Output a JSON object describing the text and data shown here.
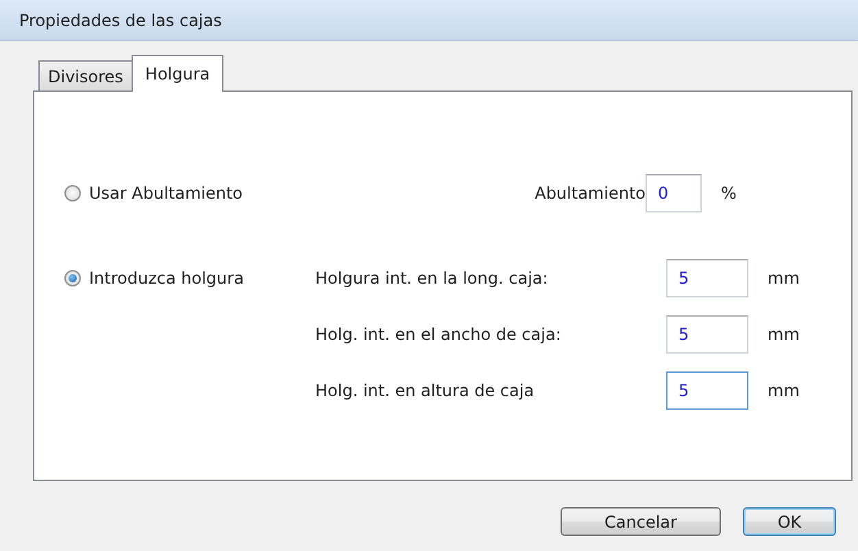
{
  "window": {
    "title": "Propiedades de las cajas"
  },
  "tabs": [
    {
      "label": "Divisores",
      "selected": false
    },
    {
      "label": "Holgura",
      "selected": true
    }
  ],
  "groups": [
    {
      "option": {
        "label": "Usar Abultamiento",
        "selected": false
      },
      "fields": [
        {
          "label": "Abultamiento",
          "value": "0",
          "unit": "%",
          "focused": false
        }
      ]
    },
    {
      "option": {
        "label": "Introduzca holgura",
        "selected": true
      },
      "fields": [
        {
          "label": "Holgura int. en la long. caja:",
          "value": "5",
          "unit": "mm",
          "focused": false
        },
        {
          "label": "Holg. int. en el ancho de caja:",
          "value": "5",
          "unit": "mm",
          "focused": false
        },
        {
          "label": "Holg. int. en altura de caja",
          "value": "5",
          "unit": "mm",
          "focused": true
        }
      ]
    }
  ],
  "buttons": [
    {
      "label": "Cancelar",
      "default": false
    },
    {
      "label": "OK",
      "default": true
    }
  ]
}
